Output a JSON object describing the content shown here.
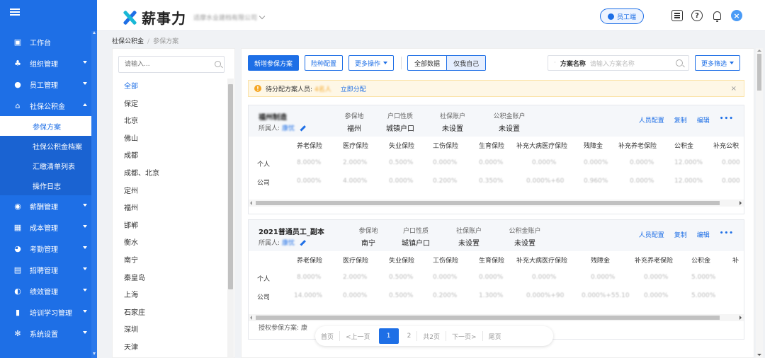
{
  "sidebar": {
    "items": [
      {
        "label": "工作台",
        "icon": "dashboard-icon"
      },
      {
        "label": "组织管理",
        "icon": "org-icon"
      },
      {
        "label": "员工管理",
        "icon": "employee-icon"
      },
      {
        "label": "社保公积金",
        "icon": "home-icon"
      }
    ],
    "sub_items": [
      {
        "label": "参保方案"
      },
      {
        "label": "社保公积金档案"
      },
      {
        "label": "汇缴清单列表"
      },
      {
        "label": "操作日志"
      }
    ],
    "items_after": [
      {
        "label": "薪酬管理",
        "icon": "salary-icon"
      },
      {
        "label": "成本管理",
        "icon": "cost-icon"
      },
      {
        "label": "考勤管理",
        "icon": "attendance-icon"
      },
      {
        "label": "招聘管理",
        "icon": "recruit-icon"
      },
      {
        "label": "绩效管理",
        "icon": "performance-icon"
      },
      {
        "label": "培训学习管理",
        "icon": "training-icon"
      },
      {
        "label": "系统设置",
        "icon": "settings-icon"
      }
    ]
  },
  "header": {
    "logo_text": "薪事力",
    "company_name": "适摩水业建档有限公司",
    "employee_button": "员工端"
  },
  "breadcrumb": {
    "parent": "社保公积金",
    "separator": "/",
    "current": "参保方案"
  },
  "city_panel": {
    "search_placeholder": "请输入...",
    "cities": [
      "全部",
      "保定",
      "北京",
      "佛山",
      "成都",
      "成都、北京",
      "定州",
      "福州",
      "邯郸",
      "衡水",
      "南宁",
      "秦皇岛",
      "上海",
      "石家庄",
      "深圳",
      "天津"
    ]
  },
  "toolbar": {
    "new_plan": "新增参保方案",
    "insurance_config": "险种配置",
    "more_actions": "更多操作",
    "all_data": "全部数据",
    "only_mine": "仅我自己",
    "scheme_label": "方案名称",
    "scheme_placeholder": "请输入方案名称",
    "more_filter": "更多筛选"
  },
  "alert": {
    "text": "待分配方案人员:",
    "count": "4名人",
    "link": "立即分配",
    "close": "×"
  },
  "cards": [
    {
      "name": "福州制造",
      "owner_label": "所属人:",
      "owner": "康忧",
      "meta": [
        {
          "k": "参保地",
          "v": "福州"
        },
        {
          "k": "户口性质",
          "v": "城镇户口"
        },
        {
          "k": "社保账户",
          "v": "未设置"
        },
        {
          "k": "公积金账户",
          "v": "未设置"
        }
      ],
      "actions": [
        "人员配置",
        "复制",
        "编辑",
        "•••"
      ],
      "headers": [
        "养老保险",
        "医疗保险",
        "失业保险",
        "工伤保险",
        "生育保险",
        "补充大病医疗保险",
        "残障金",
        "补充养老保险",
        "公积金",
        "补充公积"
      ],
      "rows": [
        {
          "label": "个人",
          "values": [
            "8.000%",
            "2.000%",
            "0.500%",
            "0.000%",
            "0.000%",
            "0.000%",
            "0.000%",
            "0.000%",
            "12.000%",
            "0.000"
          ]
        },
        {
          "label": "公司",
          "values": [
            "0.000%",
            "4.000%",
            "0.000%",
            "0.200%",
            "0.350%",
            "0.000%+60",
            "0.960%",
            "0.000%",
            "12.000%",
            "0.000"
          ]
        }
      ]
    },
    {
      "name": "2021普通员工_副本",
      "owner_label": "所属人:",
      "owner": "康忧",
      "meta": [
        {
          "k": "参保地",
          "v": "南宁"
        },
        {
          "k": "户口性质",
          "v": "城镇户口"
        },
        {
          "k": "社保账户",
          "v": "未设置"
        },
        {
          "k": "公积金账户",
          "v": "未设置"
        }
      ],
      "actions": [
        "人员配置",
        "复制",
        "编辑",
        "•••"
      ],
      "headers": [
        "养老保险",
        "医疗保险",
        "失业保险",
        "工伤保险",
        "生育保险",
        "补充大病医疗保险",
        "残障金",
        "补充养老保险",
        "公积金",
        "补"
      ],
      "rows": [
        {
          "label": "个人",
          "values": [
            "8.000%",
            "2.000%",
            "0.500%",
            "0.000%",
            "0.000%",
            "0.000%",
            "0.000%",
            "0.000%",
            "5.000%"
          ]
        },
        {
          "label": "公司",
          "values": [
            "14.000%",
            "0.000%",
            "0.500%",
            "0.200%",
            "1.300%",
            "0.000%+90",
            "0.000%+55.10",
            "0.000%",
            "5.000%"
          ]
        }
      ],
      "authorized_label": "授权参保方案: 康"
    }
  ],
  "pager": {
    "first": "首页",
    "prev": "<上一页",
    "pages": [
      "1",
      "2"
    ],
    "total": "共2页",
    "next": "下一页>",
    "last": "尾页"
  }
}
